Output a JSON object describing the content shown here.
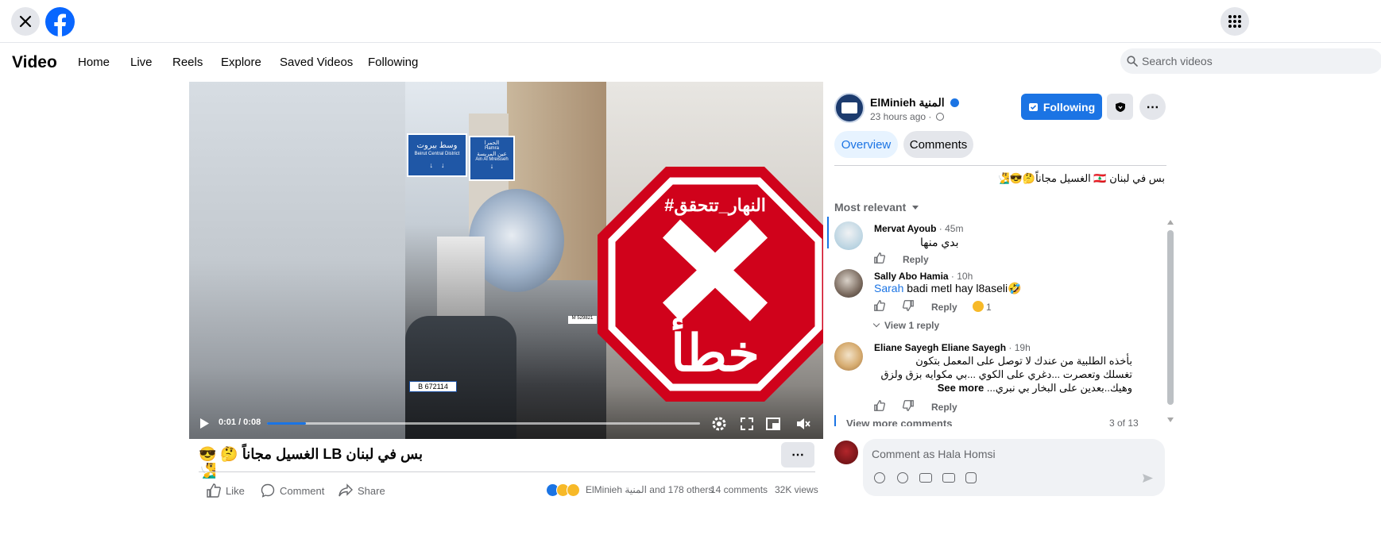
{
  "topbar": {
    "close_icon": "close-icon",
    "logo_icon": "facebook-logo-icon",
    "menu_icon": "apps-grid-icon"
  },
  "nav": {
    "title": "Video",
    "tabs": [
      "Home",
      "Live",
      "Reels",
      "Explore",
      "Saved Videos",
      "Following"
    ],
    "search_placeholder": "Search videos"
  },
  "video": {
    "signs": {
      "left_ar": "وسط بيروت",
      "left_en": "Beirut Central District",
      "right_ar": "الحمرا",
      "right_en1": "Hamra",
      "right_ar2": "عين المريسة",
      "right_en2": "Ain Al Mreisseh"
    },
    "plate": "B 672114",
    "truck_plate": "M 529821",
    "stamp_tag": "#النهار_تتحقق",
    "stamp_word": "خطأ",
    "time": "0:01 / 0:08",
    "progress": 0.09
  },
  "post": {
    "title": "بس في لبنان LB الغسيل مجاناً 🤔 😎 🧏‍♂️",
    "like": "Like",
    "comment": "Comment",
    "share": "Share",
    "reactions_text": "ElMinieh المنية and 178 others",
    "comments_count": "14 comments",
    "views": "32K views"
  },
  "panel": {
    "page_name": "ElMinieh المنية",
    "time": "23 hours ago ·",
    "following_label": "Following",
    "tab_overview": "Overview",
    "tab_comments": "Comments",
    "caption": "بس في لبنان 🇱🇧 الغسيل مجاناً🤔😎🧏‍♂️",
    "sort_label": "Most relevant",
    "comments": [
      {
        "name": "Mervat Ayoub",
        "time": " · 45m",
        "text": "بدي منها",
        "reply": "Reply"
      },
      {
        "name": "Sally Abo Hamia",
        "time": " · 10h",
        "mention": "Sarah",
        "text": " badi metl hay l8aseli🤣",
        "reply": "Reply",
        "reaction_count": "1",
        "view_replies": "View 1 reply"
      },
      {
        "name": "Eliane Sayegh Eliane Sayegh",
        "time": " · 19h",
        "line1": "بأخذه الطلبية من عندك لا توصل على المعمل بتكون",
        "line2": "تغسلك وتعصرت ...دغري على الكوي ...بي مكوايه بزق ولزق",
        "line3": "وهيك..بعدين على البخار بي نبري...",
        "see_more": "See more",
        "reply": "Reply"
      }
    ],
    "view_more": "View more comments",
    "page_count": "3 of 13",
    "comment_placeholder": "Comment as Hala Homsi"
  },
  "colors": {
    "accent": "#1b74e4",
    "stamp_red": "#d0021b",
    "tab_active_bg": "#e7f3ff"
  }
}
